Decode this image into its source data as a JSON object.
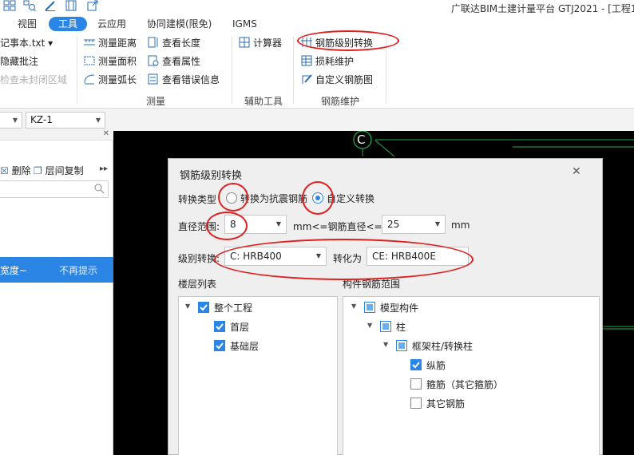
{
  "app": {
    "title": "广联达BIM土建计量平台 GTJ2021 - [工程1"
  },
  "tabs": [
    {
      "label": "视图",
      "active": false
    },
    {
      "label": "工具",
      "active": true
    },
    {
      "label": "云应用",
      "active": false
    },
    {
      "label": "协同建模(限免)",
      "active": false
    },
    {
      "label": "IGMS",
      "active": false
    }
  ],
  "ribbon": {
    "left_items": [
      "记事本.txt ▾",
      "隐藏批注",
      "检查未封闭区域"
    ],
    "measure": {
      "items": [
        "测量距离",
        "测量面积",
        "测量弧长"
      ],
      "view_items": [
        "查看长度",
        "查看属性",
        "查看错误信息"
      ],
      "label": "测量"
    },
    "aux": {
      "items": [
        "计算器"
      ],
      "label": "辅助工具"
    },
    "rebar": {
      "items": [
        "钢筋级别转换",
        "损耗维护",
        "自定义钢筋图"
      ],
      "label": "钢筋维护"
    }
  },
  "toolbar2": {
    "combo_left": "",
    "combo_kz": "KZ-1"
  },
  "leftpanel": {
    "delete_label": "删除",
    "copy_label": "层间复制",
    "tip_text": "宽度~",
    "tip_dismiss": "不再提示"
  },
  "canvas": {
    "axis_label": "C"
  },
  "dialog": {
    "title": "钢筋级别转换",
    "type_label": "转换类型",
    "option_seismic": "转换为抗震钢筋",
    "option_custom": "自定义转换",
    "selected_option": "custom",
    "diam_label": "直径范围:",
    "diam_from": "8",
    "diam_mid": "mm<=钢筋直径<=",
    "diam_to": "25",
    "diam_unit": "mm",
    "grade_label": "级别转换:",
    "grade_from": "C: HRB400",
    "convert_to_label": "转化为",
    "grade_to": "CE: HRB400E",
    "floors_title": "楼层列表",
    "floors": [
      {
        "label": "整个工程",
        "checked": true,
        "level": 0
      },
      {
        "label": "首层",
        "checked": true,
        "level": 1
      },
      {
        "label": "基础层",
        "checked": true,
        "level": 1
      }
    ],
    "comp_title": "构件钢筋范围",
    "components": [
      {
        "label": "模型构件",
        "state": "partial",
        "level": 0
      },
      {
        "label": "柱",
        "state": "partial",
        "level": 1
      },
      {
        "label": "框架柱/转换柱",
        "state": "partial",
        "level": 2
      },
      {
        "label": "纵筋",
        "state": "checked",
        "level": 3
      },
      {
        "label": "箍筋（其它箍筋）",
        "state": "unchecked",
        "level": 3
      },
      {
        "label": "其它钢筋",
        "state": "unchecked",
        "level": 3
      }
    ]
  },
  "colors": {
    "accent": "#2b85e4",
    "annotation_red": "#e02020",
    "canvas_bg": "#000000",
    "canvas_line": "#22b14c"
  }
}
